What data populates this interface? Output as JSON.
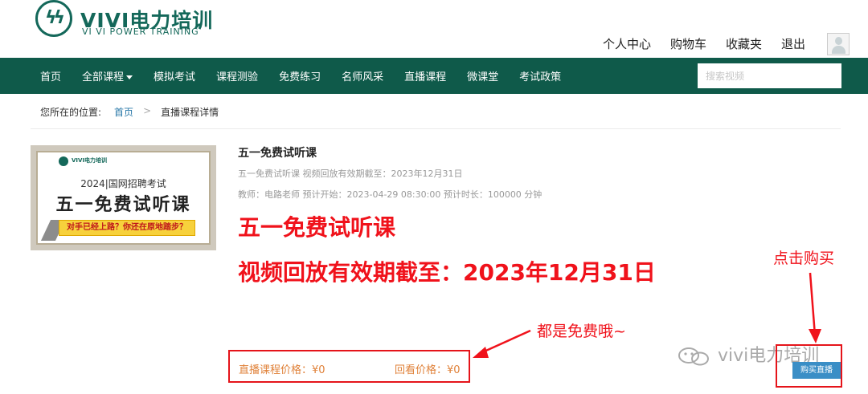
{
  "logo": {
    "title": "VIVI电力培训",
    "subtitle": "VI VI POWER TRAINING"
  },
  "top_links": {
    "personal": "个人中心",
    "cart": "购物车",
    "favorites": "收藏夹",
    "logout": "退出"
  },
  "nav": {
    "items": [
      "首页",
      "全部课程",
      "模拟考试",
      "课程测验",
      "免费练习",
      "名师风采",
      "直播课程",
      "微课堂",
      "考试政策"
    ],
    "search_placeholder": "搜索视频"
  },
  "breadcrumb": {
    "label": "您所在的位置:",
    "home": "首页",
    "separator": ">",
    "current": "直播课程详情"
  },
  "thumbnail": {
    "brand": "VIVI电力培训",
    "year_line": "2024|国网招聘考试",
    "title": "五一免费试听课",
    "banner": "对手已经上路？你还在原地踏步？"
  },
  "course": {
    "title": "五一免费试听课",
    "description": "五一免费试听课 视频回放有效期截至：2023年12月31日",
    "meta": "教师：电路老师   预计开始：2023-04-29 08:30:00   预计时长：100000 分钟",
    "highlight_line1": "五一免费试听课",
    "highlight_line2": "视频回放有效期截至：2023年12月31日"
  },
  "prices": {
    "live": "直播课程价格：¥0",
    "replay": "回看价格：¥0"
  },
  "annotations": {
    "click_to_buy": "点击购买",
    "all_free": "都是免费哦~"
  },
  "watermark": "vivi电力培训",
  "buy_button": "购买直播",
  "colors": {
    "nav": "#0f5a4a",
    "brand": "#14685a",
    "highlight": "#f0121b",
    "price": "#e0823a",
    "buy": "#3a8ec6"
  }
}
